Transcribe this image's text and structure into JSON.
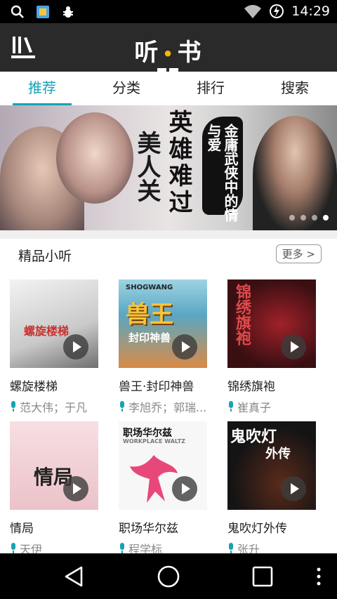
{
  "status_bar": {
    "time": "14:29"
  },
  "app": {
    "title_left": "听",
    "title_dot": "•",
    "title_right": "书"
  },
  "tabs": [
    {
      "label": "推荐",
      "active": true
    },
    {
      "label": "分类",
      "active": false
    },
    {
      "label": "排行",
      "active": false
    },
    {
      "label": "搜索",
      "active": false
    }
  ],
  "banner": {
    "calligraphy_1": "英雄难过",
    "calligraphy_2": "美人关",
    "ink_text": "金庸武侠中的情与爱",
    "page_count": 4,
    "active_page": 4
  },
  "section": {
    "title": "精品小听",
    "more_label": "更多 >"
  },
  "books": [
    {
      "title": "螺旋楼梯",
      "narrator": "范大伟；于凡",
      "cover_text": "螺旋楼梯",
      "cover_color": "#dcdcdc"
    },
    {
      "title": "兽王·封印神兽",
      "narrator": "李旭乔；郭瑞...",
      "cover_text": "兽王",
      "cover_sub": "封印神兽",
      "cover_brand": "SHOGWANG",
      "cover_color": "#6ab0c8"
    },
    {
      "title": "锦绣旗袍",
      "narrator": "崔真子",
      "cover_text": "锦绣旗袍",
      "cover_color": "#3a0f12"
    },
    {
      "title": "情局",
      "narrator": "天伊",
      "cover_text": "情局",
      "cover_color": "#f1d3d8"
    },
    {
      "title": "职场华尔兹",
      "narrator": "程学标",
      "cover_text": "职场华尔兹",
      "cover_sub": "WORKPLACE WALTZ",
      "cover_color": "#f7f7f7"
    },
    {
      "title": "鬼吹灯外传",
      "narrator": "张升",
      "cover_text": "鬼吹灯",
      "cover_sub": "外传",
      "cover_color": "#141414"
    }
  ],
  "colors": {
    "accent": "#15a4b3",
    "header": "#2a2a2a",
    "narrator_icon": "#15a4b3"
  }
}
